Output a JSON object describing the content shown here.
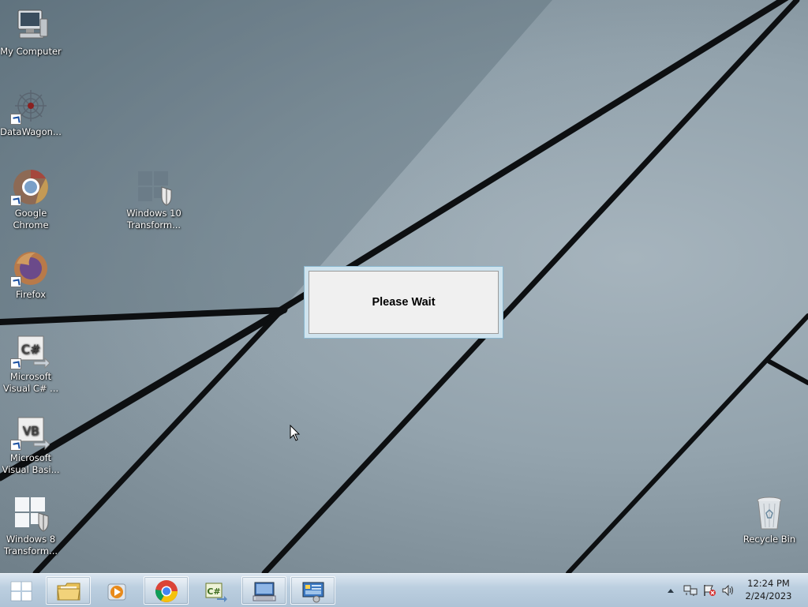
{
  "desktop": {
    "icons": [
      {
        "label": "My Computer",
        "icon": "computer-icon"
      },
      {
        "label": "DataWagon...",
        "icon": "datawagon-icon"
      },
      {
        "label": "Google Chrome",
        "icon": "chrome-icon"
      },
      {
        "label": "Windows 10 Transform...",
        "icon": "windows-shield-icon"
      },
      {
        "label": "Firefox",
        "icon": "firefox-icon"
      },
      {
        "label": "Microsoft Visual C# ...",
        "icon": "visual-csharp-icon"
      },
      {
        "label": "Microsoft Visual Basi...",
        "icon": "visual-basic-icon"
      },
      {
        "label": "Windows 8 Transform...",
        "icon": "windows-shield-icon"
      },
      {
        "label": "Recycle Bin",
        "icon": "recycle-bin-icon"
      }
    ]
  },
  "dialog": {
    "message": "Please Wait"
  },
  "taskbar": {
    "start_icon": "windows-start-icon",
    "pinned": [
      {
        "name": "file-explorer",
        "icon": "folder-icon"
      },
      {
        "name": "media-player",
        "icon": "media-player-icon"
      },
      {
        "name": "chrome",
        "icon": "chrome-icon"
      },
      {
        "name": "visual-csharp",
        "icon": "visual-csharp-icon"
      },
      {
        "name": "remote-desktop",
        "icon": "remote-desktop-icon"
      },
      {
        "name": "control-panel",
        "icon": "control-panel-icon"
      }
    ],
    "tray": {
      "icons": [
        "show-hidden-icons-arrow",
        "network-icon",
        "action-center-flag-icon",
        "volume-icon"
      ],
      "time": "12:24 PM",
      "date": "2/24/2023"
    }
  },
  "colors": {
    "dialog_border": "#8ab7cf",
    "dialog_bg": "#f0f0f0",
    "taskbar": "#bccfe0"
  }
}
